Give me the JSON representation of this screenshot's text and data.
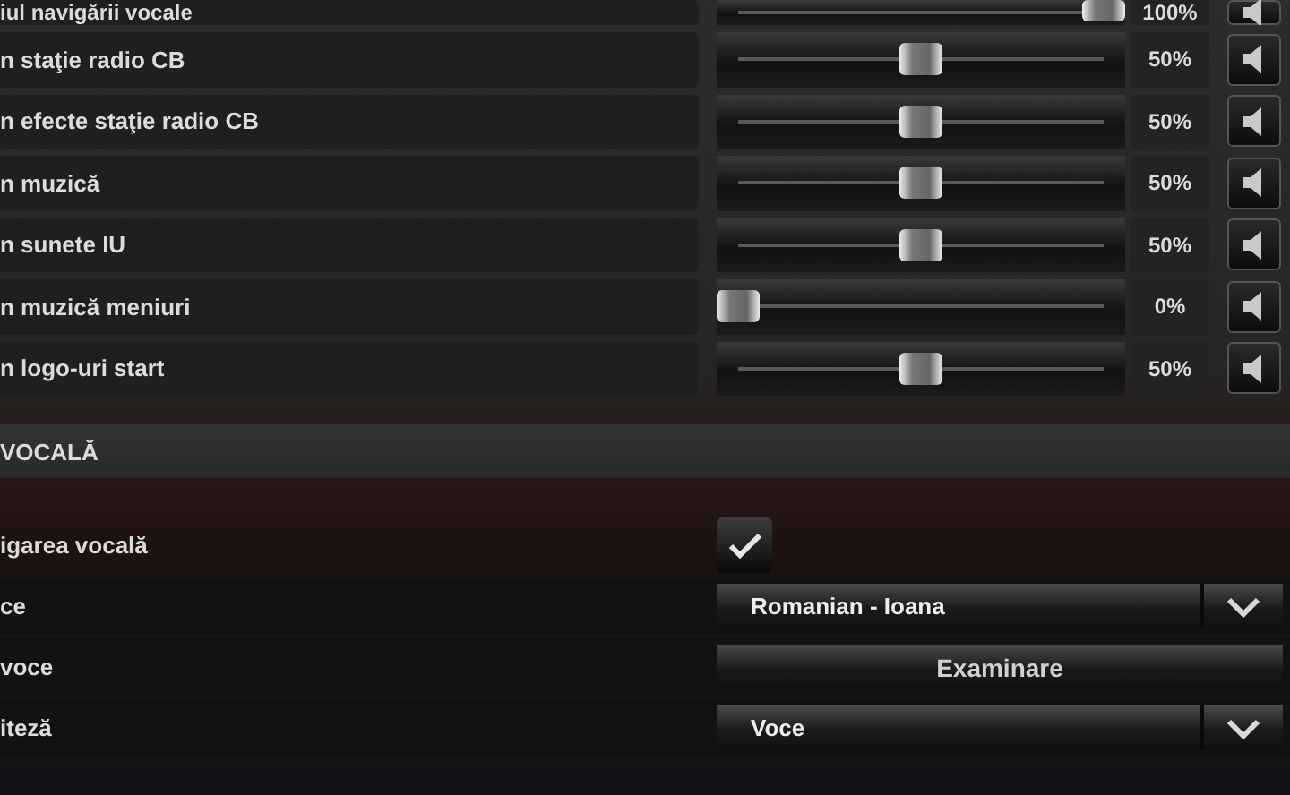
{
  "volume_rows": [
    {
      "label": "iul navigării vocale",
      "level": 1,
      "reading": "100%",
      "muted": false
    },
    {
      "label": "n staţie radio CB",
      "level": 0.5,
      "reading": "50%",
      "muted": false
    },
    {
      "label": "n efecte staţie radio CB",
      "level": 0.5,
      "reading": "50%",
      "muted": false
    },
    {
      "label": "n muzică",
      "level": 0.5,
      "reading": "50%",
      "muted": false
    },
    {
      "label": "n sunete IU",
      "level": 0.5,
      "reading": "50%",
      "muted": false
    },
    {
      "label": "n muzică meniuri",
      "level": 0,
      "reading": "0%",
      "muted": false
    },
    {
      "label": "n logo-uri start",
      "level": 0.5,
      "reading": "50%",
      "muted": false
    }
  ],
  "section": {
    "title": "VOCALĂ"
  },
  "voice_rows": [
    {
      "kind": "checkbox",
      "label": "igarea vocală",
      "checked": true
    },
    {
      "kind": "dropdown",
      "label": "ce",
      "value": "Romanian - Ioana"
    },
    {
      "kind": "button",
      "label": "voce",
      "value": "Examinare"
    },
    {
      "kind": "dropdown",
      "label": "iteză",
      "value": "Voce"
    }
  ]
}
